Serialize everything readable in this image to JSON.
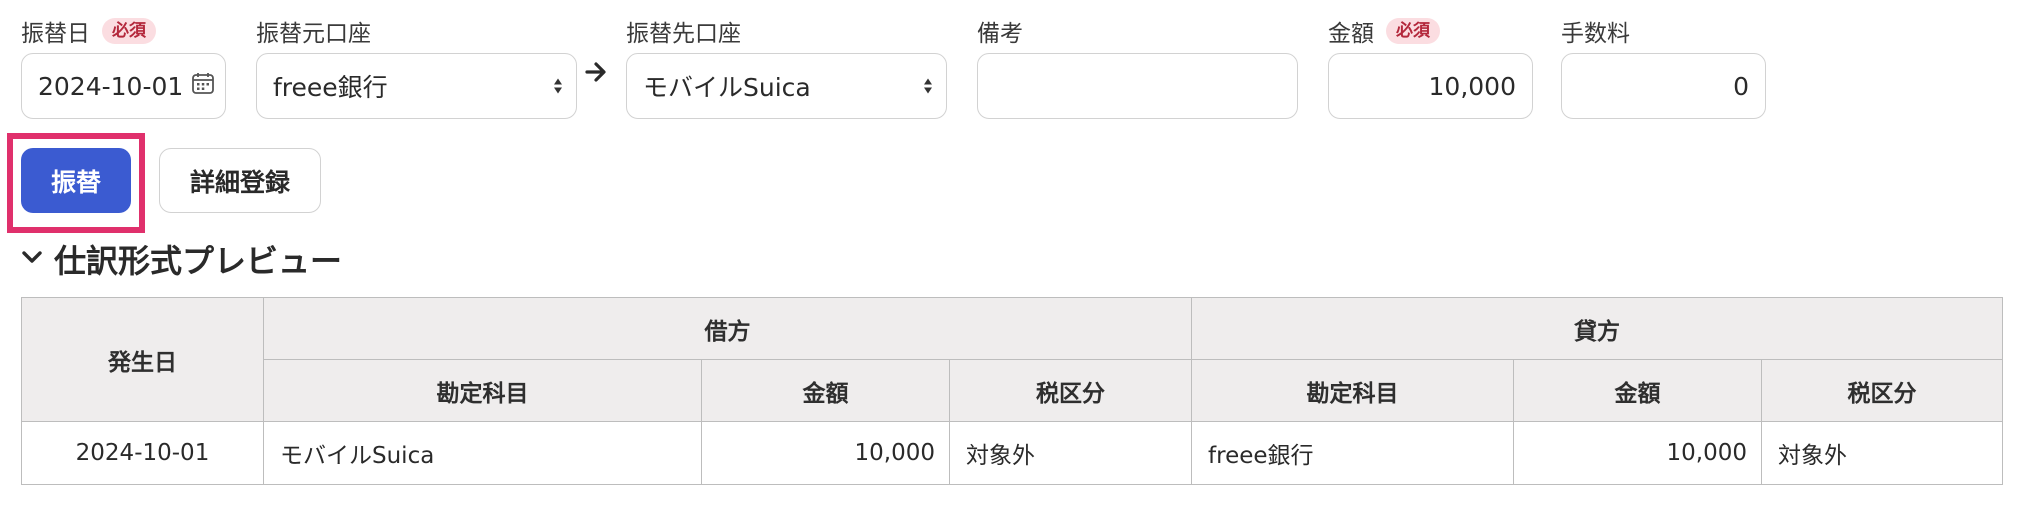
{
  "form": {
    "date": {
      "label": "振替日",
      "required_badge": "必須",
      "value": "2024-10-01"
    },
    "from_account": {
      "label": "振替元口座",
      "value": "freee銀行"
    },
    "to_account": {
      "label": "振替先口座",
      "value": "モバイルSuica"
    },
    "note": {
      "label": "備考",
      "value": ""
    },
    "amount": {
      "label": "金額",
      "required_badge": "必須",
      "value": "10,000"
    },
    "fee": {
      "label": "手数料",
      "value": "0"
    }
  },
  "actions": {
    "transfer_label": "振替",
    "detail_label": "詳細登録"
  },
  "preview": {
    "title": "仕訳形式プレビュー",
    "headers": {
      "date": "発生日",
      "debit": "借方",
      "credit": "貸方",
      "account": "勘定科目",
      "amount": "金額",
      "tax": "税区分"
    },
    "rows": [
      {
        "date": "2024-10-01",
        "debit_account": "モバイルSuica",
        "debit_amount": "10,000",
        "debit_tax": "対象外",
        "credit_account": "freee銀行",
        "credit_amount": "10,000",
        "credit_tax": "対象外"
      }
    ]
  },
  "colors": {
    "primary_button": "#3b5bd1",
    "highlight_frame": "#e0306c",
    "required_badge_bg": "#fbdde1",
    "required_badge_text": "#b4283c"
  }
}
